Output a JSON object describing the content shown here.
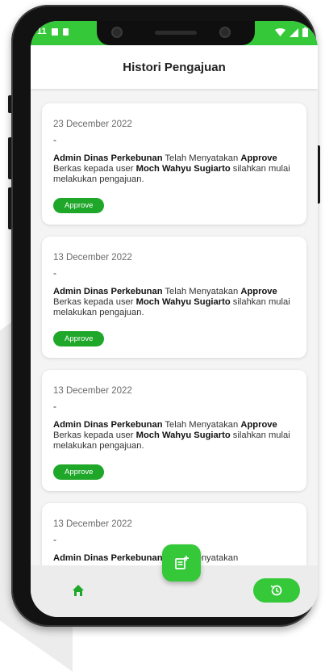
{
  "colors": {
    "accent": "#35c93a",
    "badge": "#1fa72a",
    "frame": "#121212",
    "background": "#f4f4f4"
  },
  "status_bar": {
    "time": "11"
  },
  "header": {
    "title": "Histori Pengajuan"
  },
  "cards": [
    {
      "date": "23 December 2022",
      "dash": "-",
      "admin": "Admin Dinas Perkebunan",
      "text1": " Telah Menyatakan ",
      "status_word": "Approve",
      "text2": " Berkas kepada user ",
      "user": "Moch Wahyu Sugiarto",
      "text3": " silahkan mulai melakukan pengajuan.",
      "badge": "Approve"
    },
    {
      "date": "13 December 2022",
      "dash": "-",
      "admin": "Admin Dinas Perkebunan",
      "text1": " Telah Menyatakan ",
      "status_word": "Approve",
      "text2": " Berkas kepada user ",
      "user": "Moch Wahyu Sugiarto",
      "text3": " silahkan mulai melakukan pengajuan.",
      "badge": "Approve"
    },
    {
      "date": "13 December 2022",
      "dash": "-",
      "admin": "Admin Dinas Perkebunan",
      "text1": " Telah Menyatakan ",
      "status_word": "Approve",
      "text2": " Berkas kepada user ",
      "user": "Moch Wahyu Sugiarto",
      "text3": " silahkan mulai melakukan pengajuan.",
      "badge": "Approve"
    },
    {
      "date": "13 December 2022",
      "dash": "-",
      "admin": "Admin Dinas Perkebunan",
      "text1": " Telah Menyatakan",
      "status_word": "",
      "text2": "",
      "user": "",
      "text3": "",
      "badge": ""
    }
  ],
  "bottom_nav": {
    "home_icon": "home-icon",
    "fab_icon": "add-document-icon",
    "history_icon": "history-icon"
  }
}
